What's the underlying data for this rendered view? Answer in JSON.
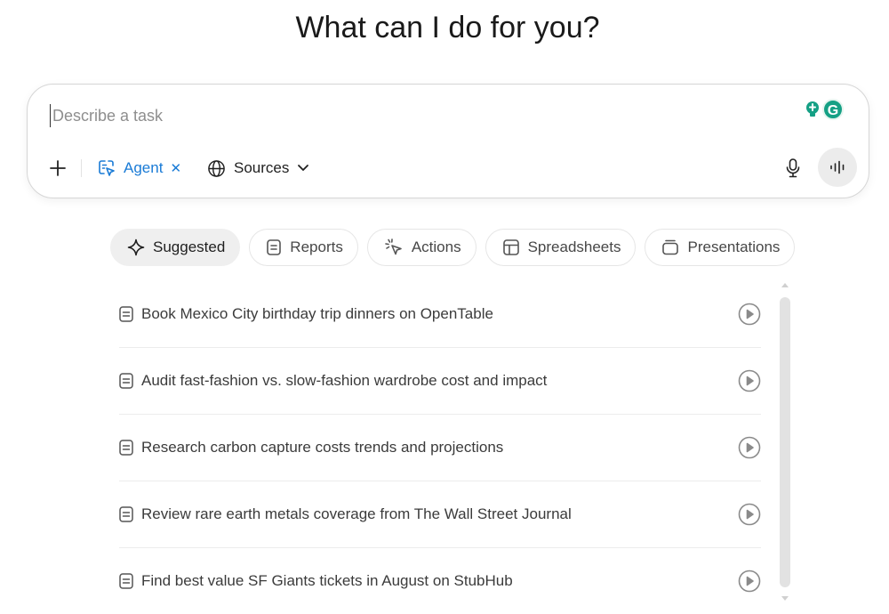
{
  "heading": "What can I do for you?",
  "composer": {
    "placeholder": "Describe a task",
    "value": "",
    "agent_label": "Agent",
    "agent_remove": "✕",
    "sources_label": "Sources",
    "extension_badge": "G"
  },
  "tabs": [
    {
      "label": "Suggested",
      "icon": "sparkle-icon",
      "active": true
    },
    {
      "label": "Reports",
      "icon": "document-icon",
      "active": false
    },
    {
      "label": "Actions",
      "icon": "cursor-click-icon",
      "active": false
    },
    {
      "label": "Spreadsheets",
      "icon": "table-icon",
      "active": false
    },
    {
      "label": "Presentations",
      "icon": "slides-icon",
      "active": false
    }
  ],
  "suggestions": [
    {
      "text": "Book Mexico City birthday trip dinners on OpenTable"
    },
    {
      "text": "Audit fast-fashion vs. slow-fashion wardrobe cost and impact"
    },
    {
      "text": "Research carbon capture costs trends and projections"
    },
    {
      "text": "Review rare earth metals coverage from The Wall Street Journal"
    },
    {
      "text": "Find best value SF Giants tickets in August on StubHub"
    }
  ],
  "colors": {
    "accent": "#1a7bd6",
    "text": "#1f1f1f",
    "muted": "#8e8e8e",
    "active_tab_bg": "#efefef",
    "extension_green": "#15a085"
  }
}
